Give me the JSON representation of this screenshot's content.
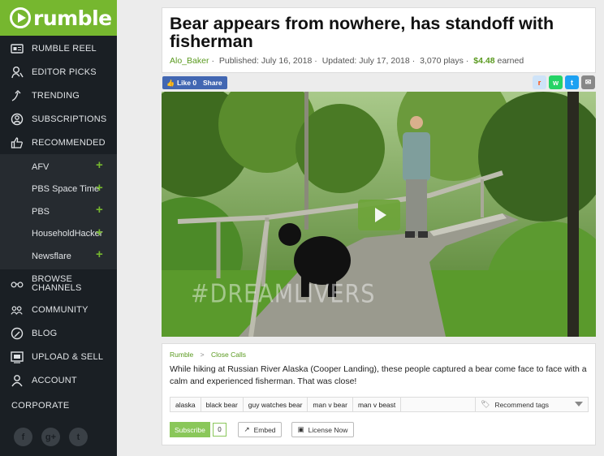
{
  "brand": {
    "name": "rumble",
    "color": "#76b72f"
  },
  "sidebar": {
    "items": [
      {
        "label": "RUMBLE REEL",
        "icon": "reel-icon"
      },
      {
        "label": "EDITOR PICKS",
        "icon": "editor-person-icon"
      },
      {
        "label": "TRENDING",
        "icon": "trending-icon"
      },
      {
        "label": "SUBSCRIPTIONS",
        "icon": "subscriptions-icon"
      },
      {
        "label": "RECOMMENDED",
        "icon": "thumbs-up-icon"
      }
    ],
    "subscriptions": [
      "AFV",
      "PBS Space Time",
      "PBS",
      "HouseholdHacker",
      "Newsflare"
    ],
    "items2": [
      {
        "label_line1": "BROWSE",
        "label_line2": "CHANNELS",
        "icon": "glasses-icon"
      },
      {
        "label": "COMMUNITY",
        "icon": "community-icon"
      },
      {
        "label": "BLOG",
        "icon": "blog-icon"
      },
      {
        "label": "UPLOAD & SELL",
        "icon": "upload-icon"
      },
      {
        "label": "ACCOUNT",
        "icon": "account-icon"
      }
    ],
    "corporate": "CORPORATE",
    "socials": [
      {
        "icon": "facebook-icon",
        "glyph": "f"
      },
      {
        "icon": "google-plus-icon",
        "glyph": "g+"
      },
      {
        "icon": "twitter-icon",
        "glyph": "t"
      }
    ]
  },
  "video": {
    "title": "Bear appears from nowhere, has standoff with fisherman",
    "author": "Alo_Baker",
    "published": "Published: July 16, 2018",
    "updated": "Updated: July 17, 2018",
    "plays": "3,070 plays",
    "earned_amount": "$4.48",
    "earned_label": "earned",
    "watermark": "#DREAMLIVERS"
  },
  "share": {
    "like_label": "Like 0",
    "share_label": "Share",
    "icons": [
      {
        "name": "reddit-icon",
        "color": "#cee3f8",
        "glyph": "r"
      },
      {
        "name": "whatsapp-icon",
        "color": "#25d366",
        "glyph": "w"
      },
      {
        "name": "twitter-share-icon",
        "color": "#1da1f2",
        "glyph": "t"
      },
      {
        "name": "email-icon",
        "color": "#888888",
        "glyph": "✉"
      }
    ]
  },
  "description": {
    "breadcrumb": [
      "Rumble",
      "Close Calls"
    ],
    "breadcrumb_sep": ">",
    "text": "While hiking at Russian River Alaska (Cooper Landing), these people captured a bear come face to face with a calm and experienced fisherman. That was close!",
    "tags": [
      "alaska",
      "black bear",
      "guy watches bear",
      "man v bear",
      "man v beast"
    ],
    "recommend_label": "Recommend tags"
  },
  "actions": {
    "subscribe_label": "Subscribe",
    "subscribe_count": "0",
    "embed_label": "Embed",
    "license_label": "License Now"
  }
}
